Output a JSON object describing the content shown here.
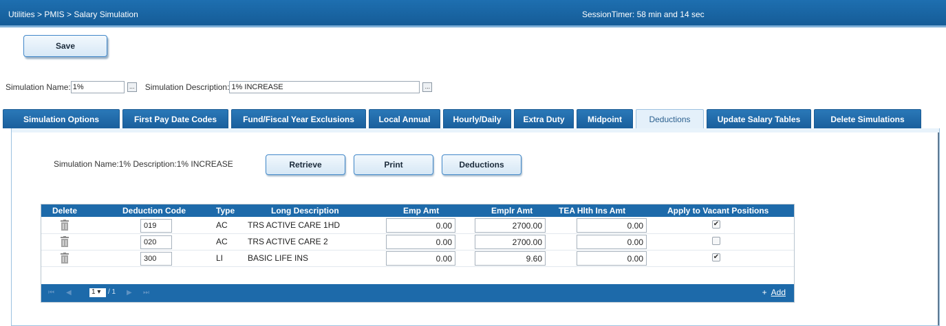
{
  "header": {
    "breadcrumb": "Utilities > PMIS > Salary Simulation",
    "session_timer": "SessionTimer: 58 min and 14 sec"
  },
  "toolbar": {
    "save_label": "Save"
  },
  "simulation": {
    "name_label": "Simulation Name:",
    "name_value": "1%",
    "desc_label": "Simulation Description:",
    "desc_value": "1% INCREASE",
    "ellipsis": "..."
  },
  "tabs": [
    {
      "label": "Simulation Options"
    },
    {
      "label": "First Pay Date Codes"
    },
    {
      "label": "Fund/Fiscal Year Exclusions"
    },
    {
      "label": "Local Annual"
    },
    {
      "label": "Hourly/Daily"
    },
    {
      "label": "Extra Duty"
    },
    {
      "label": "Midpoint"
    },
    {
      "label": "Deductions"
    },
    {
      "label": "Update Salary Tables"
    },
    {
      "label": "Delete Simulations"
    }
  ],
  "active_tab": "Deductions",
  "panel": {
    "info": "Simulation Name:1%   Description:1% INCREASE",
    "retrieve_label": "Retrieve",
    "print_label": "Print",
    "deductions_label": "Deductions"
  },
  "grid": {
    "columns": [
      "Delete",
      "Deduction Code",
      "Type",
      "Long Description",
      "Emp Amt",
      "Emplr Amt",
      "TEA Hlth Ins Amt",
      "Apply to Vacant Positions"
    ],
    "rows": [
      {
        "code": "019",
        "type": "AC",
        "desc": "TRS ACTIVE CARE 1HD",
        "emp": "0.00",
        "emplr": "2700.00",
        "tea": "0.00",
        "apply": "✔"
      },
      {
        "code": "020",
        "type": "AC",
        "desc": "TRS ACTIVE CARE 2",
        "emp": "0.00",
        "emplr": "2700.00",
        "tea": "0.00",
        "apply": ""
      },
      {
        "code": "300",
        "type": "LI",
        "desc": "BASIC LIFE INS",
        "emp": "0.00",
        "emplr": "9.60",
        "tea": "0.00",
        "apply": "✔"
      }
    ],
    "pager": {
      "first": "⏮",
      "prev": "◀",
      "next": "▶",
      "last": "⏭",
      "page": "1 ▾",
      "total": "/ 1",
      "add_plus": "+",
      "add_label": "Add"
    }
  }
}
